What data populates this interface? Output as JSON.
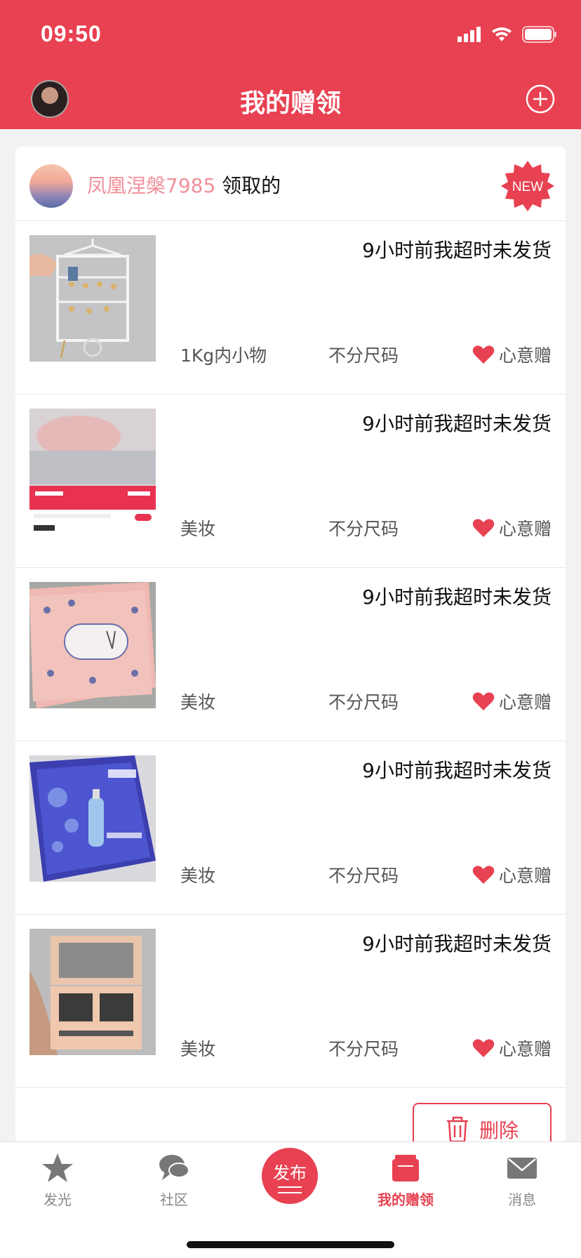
{
  "status_bar": {
    "time": "09:50"
  },
  "header": {
    "title": "我的赠领"
  },
  "giver": {
    "name": "凤凰涅槃7985",
    "suffix": " 领取的",
    "badge": "NEW"
  },
  "items": [
    {
      "status": "9小时前我超时未发货",
      "category": "1Kg内小物",
      "size": "不分尺码",
      "type": "心意赠",
      "thumb": "jewelry-stand"
    },
    {
      "status": "9小时前我超时未发货",
      "category": "美妆",
      "size": "不分尺码",
      "type": "心意赠",
      "thumb": "nail-polish-ad"
    },
    {
      "status": "9小时前我超时未发货",
      "category": "美妆",
      "size": "不分尺码",
      "type": "心意赠",
      "thumb": "wipes-pack"
    },
    {
      "status": "9小时前我超时未发货",
      "category": "美妆",
      "size": "不分尺码",
      "type": "心意赠",
      "thumb": "face-mask"
    },
    {
      "status": "9小时前我超时未发货",
      "category": "美妆",
      "size": "不分尺码",
      "type": "心意赠",
      "thumb": "eyebrow-palette"
    }
  ],
  "actions": {
    "delete_label": "删除"
  },
  "tabbar": {
    "tabs": [
      {
        "label": "发光",
        "icon": "star-icon"
      },
      {
        "label": "社区",
        "icon": "chat-icon"
      },
      {
        "label": "发布",
        "icon": "publish-icon"
      },
      {
        "label": "我的赠领",
        "icon": "gift-box-icon",
        "active": true
      },
      {
        "label": "消息",
        "icon": "mail-icon"
      }
    ]
  },
  "colors": {
    "brand": "#e84151",
    "giver_name": "#f0909a"
  }
}
